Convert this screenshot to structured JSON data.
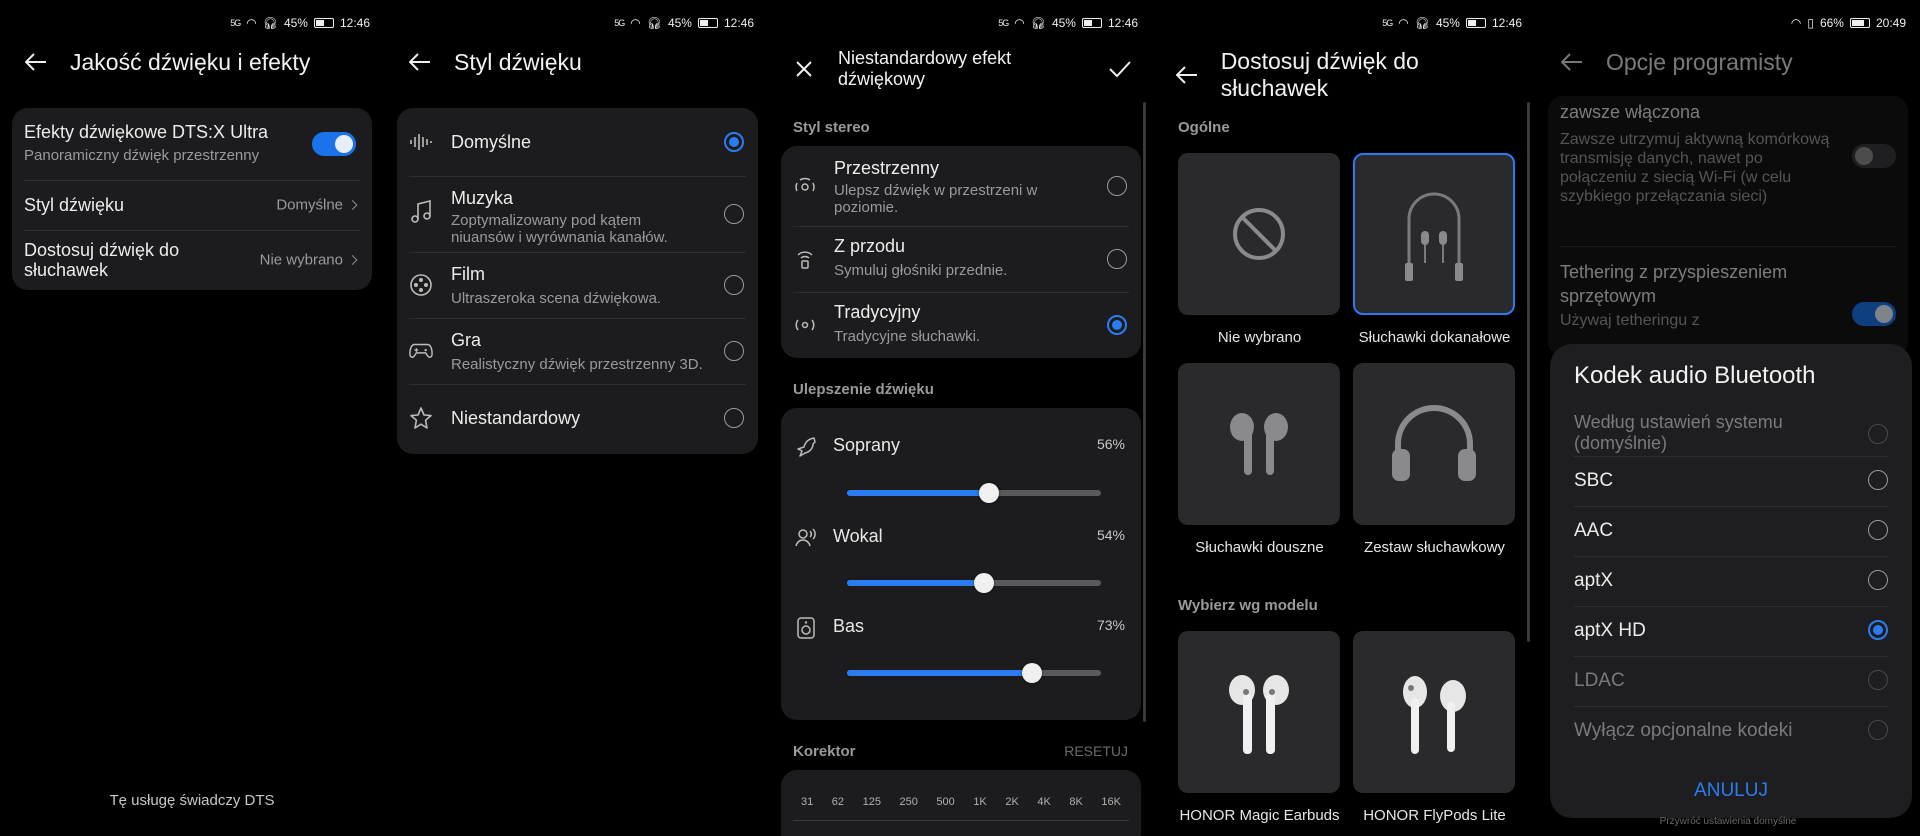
{
  "status_bars": [
    {
      "left": "5G",
      "time": "12:46",
      "battery": "45%"
    },
    {
      "left": "5G",
      "time": "12:46",
      "battery": "45%"
    },
    {
      "left": "5G",
      "time": "12:46",
      "battery": "45%"
    },
    {
      "left": "5G",
      "time": "12:46",
      "battery": "45%"
    },
    {
      "left": "",
      "time": "20:49",
      "battery": "66%"
    }
  ],
  "screen1": {
    "title": "Jakość dźwięku i efekty",
    "dts_label": "Efekty dźwiękowe DTS:X Ultra",
    "dts_sub": "Panoramiczny dźwięk przestrzenny",
    "dts_on": true,
    "style_label": "Styl dźwięku",
    "style_value": "Domyślne",
    "headphones_label": "Dostosuj dźwięk do słuchawek",
    "headphones_value": "Nie wybrano",
    "footer": "Tę usługę świadczy DTS"
  },
  "screen2": {
    "title": "Styl dźwięku",
    "items": [
      {
        "label": "Domyślne",
        "sub": "",
        "icon": "waveform-icon",
        "selected": true
      },
      {
        "label": "Muzyka",
        "sub": "Zoptymalizowany pod kątem niuansów i wyrównania kanałów.",
        "icon": "music-note-icon",
        "selected": false
      },
      {
        "label": "Film",
        "sub": "Ultraszeroka scena dźwiękowa.",
        "icon": "film-reel-icon",
        "selected": false
      },
      {
        "label": "Gra",
        "sub": "Realistyczny dźwięk przestrzenny 3D.",
        "icon": "gamepad-icon",
        "selected": false
      },
      {
        "label": "Niestandardowy",
        "sub": "",
        "icon": "star-icon",
        "selected": false
      }
    ]
  },
  "screen3": {
    "title": "Niestandardowy efekt dźwiękowy",
    "stereo_section": "Styl stereo",
    "stereo": [
      {
        "label": "Przestrzenny",
        "sub": "Ulepsz dźwięk w przestrzeni w poziomie.",
        "selected": false
      },
      {
        "label": "Z przodu",
        "sub": "Symuluj głośniki przednie.",
        "selected": false
      },
      {
        "label": "Tradycyjny",
        "sub": "Tradycyjne słuchawki.",
        "selected": true
      }
    ],
    "enhance_section": "Ulepszenie dźwięku",
    "sliders": [
      {
        "label": "Soprany",
        "value_text": "56%",
        "value": 56
      },
      {
        "label": "Wokal",
        "value_text": "54%",
        "value": 54
      },
      {
        "label": "Bas",
        "value_text": "73%",
        "value": 73
      }
    ],
    "eq_section": "Korektor",
    "eq_reset": "RESETUJ",
    "eq_bands": [
      "31",
      "62",
      "125",
      "250",
      "500",
      "1K",
      "2K",
      "4K",
      "8K",
      "16K"
    ]
  },
  "screen4": {
    "title": "Dostosuj dźwięk do słuchawek",
    "general_section": "Ogólne",
    "tiles": [
      {
        "label": "Nie wybrano",
        "icon": "no-selection-icon",
        "selected": false
      },
      {
        "label": "Słuchawki dokanałowe",
        "icon": "in-ear-headphones-icon",
        "selected": true
      },
      {
        "label": "Słuchawki douszne",
        "icon": "earbuds-icon",
        "selected": false
      },
      {
        "label": "Zestaw słuchawkowy",
        "icon": "over-ear-headset-icon",
        "selected": false
      }
    ],
    "model_section": "Wybierz wg modelu",
    "models": [
      {
        "label": "HONOR Magic Earbuds",
        "icon": "magic-earbuds-icon"
      },
      {
        "label": "HONOR FlyPods Lite",
        "icon": "flypods-icon"
      }
    ]
  },
  "screen5": {
    "title": "Opcje programisty",
    "bg_item1_title": "zawsze włączona",
    "bg_item1_sub": "Zawsze utrzymuj aktywną komórkową transmisję danych, nawet po połączeniu z siecią Wi-Fi (w celu szybkiego przełączania sieci)",
    "bg_item2_title": "Tethering z przyspieszeniem sprzętowym",
    "bg_item2_sub": "Używaj tetheringu z",
    "dialog_title": "Kodek audio Bluetooth",
    "codecs": [
      {
        "label": "Według ustawień systemu (domyślnie)",
        "selected": false,
        "enabled": false
      },
      {
        "label": "SBC",
        "selected": false,
        "enabled": true
      },
      {
        "label": "AAC",
        "selected": false,
        "enabled": true
      },
      {
        "label": "aptX",
        "selected": false,
        "enabled": true
      },
      {
        "label": "aptX HD",
        "selected": true,
        "enabled": true
      },
      {
        "label": "LDAC",
        "selected": false,
        "enabled": false
      },
      {
        "label": "Wyłącz opcjonalne kodeki",
        "selected": false,
        "enabled": false
      }
    ],
    "cancel": "ANULUJ",
    "footer": "Przywróć ustawienia domyślne"
  },
  "colors": {
    "accent": "#2b7cf0",
    "card": "#1c1c1e",
    "background": "#000000"
  }
}
